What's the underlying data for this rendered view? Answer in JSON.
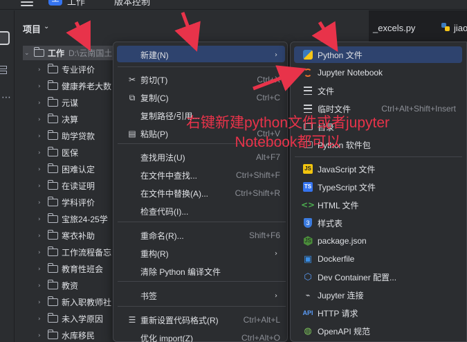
{
  "topbar": {
    "project_badge": "工",
    "project_name": "工作",
    "vcs_label": "版本控制"
  },
  "sidebar": {
    "header_label": "项目",
    "header_chevron": "⌄"
  },
  "editor_tabs": [
    {
      "label": "_excels.py"
    },
    {
      "label": "jiao"
    }
  ],
  "tree": {
    "root": {
      "label": "工作",
      "path": "D:\\云南国土"
    },
    "items": [
      "专业评价",
      "健康养老大数",
      "元谋",
      "决算",
      "助学贷款",
      "医保",
      "困难认定",
      "在读证明",
      "学科评价",
      "宝旅24-25学",
      "寒衣补助",
      "工作流程备忘",
      "教育性班会",
      "教资",
      "新入职教师社",
      "未入学原因",
      "水库移民"
    ]
  },
  "context_menu": {
    "items": [
      {
        "label": "新建(N)",
        "shortcut": "",
        "icon": "",
        "submenu": true
      },
      {
        "label": "剪切(T)",
        "shortcut": "Ctrl+X",
        "icon": "scissors-icon"
      },
      {
        "label": "复制(C)",
        "shortcut": "Ctrl+C",
        "icon": "copy-icon"
      },
      {
        "label": "复制路径/引用...",
        "shortcut": "",
        "icon": ""
      },
      {
        "label": "粘贴(P)",
        "shortcut": "Ctrl+V",
        "icon": "paste-icon"
      },
      {
        "label": "查找用法(U)",
        "shortcut": "Alt+F7",
        "icon": ""
      },
      {
        "label": "在文件中查找...",
        "shortcut": "Ctrl+Shift+F",
        "icon": ""
      },
      {
        "label": "在文件中替换(A)...",
        "shortcut": "Ctrl+Shift+R",
        "icon": ""
      },
      {
        "label": "检查代码(I)...",
        "shortcut": "",
        "icon": ""
      },
      {
        "label": "重命名(R)...",
        "shortcut": "Shift+F6",
        "icon": ""
      },
      {
        "label": "重构(R)",
        "shortcut": "",
        "icon": "",
        "submenu": true
      },
      {
        "label": "清除 Python 编译文件",
        "shortcut": "",
        "icon": ""
      },
      {
        "label": "书签",
        "shortcut": "",
        "icon": "",
        "submenu": true
      },
      {
        "label": "重新设置代码格式(R)",
        "shortcut": "Ctrl+Alt+L",
        "icon": "format-icon"
      },
      {
        "label": "优化 import(Z)",
        "shortcut": "Ctrl+Alt+O",
        "icon": ""
      }
    ]
  },
  "new_submenu": {
    "items": [
      {
        "label": "Python 文件",
        "shortcut": "",
        "icon": "python-file-icon"
      },
      {
        "label": "Jupyter Notebook",
        "shortcut": "",
        "icon": "jupyter-icon"
      },
      {
        "label": "文件",
        "shortcut": "",
        "icon": "file-icon"
      },
      {
        "label": "临时文件",
        "shortcut": "Ctrl+Alt+Shift+Insert",
        "icon": "scratch-file-icon"
      },
      {
        "label": "目录",
        "shortcut": "",
        "icon": "directory-icon"
      },
      {
        "label": "Python 软件包",
        "shortcut": "",
        "icon": "python-package-icon"
      },
      {
        "label": "JavaScript 文件",
        "shortcut": "",
        "icon": "javascript-icon",
        "glyph": "JS"
      },
      {
        "label": "TypeScript 文件",
        "shortcut": "",
        "icon": "typescript-icon",
        "glyph": "TS"
      },
      {
        "label": "HTML 文件",
        "shortcut": "",
        "icon": "html-icon",
        "glyph": "<>"
      },
      {
        "label": "样式表",
        "shortcut": "",
        "icon": "stylesheet-icon",
        "glyph": "3"
      },
      {
        "label": "package.json",
        "shortcut": "",
        "icon": "nodejs-icon",
        "glyph": "JS"
      },
      {
        "label": "Dockerfile",
        "shortcut": "",
        "icon": "docker-icon"
      },
      {
        "label": "Dev Container 配置...",
        "shortcut": "",
        "icon": "dev-container-icon"
      },
      {
        "label": "Jupyter 连接",
        "shortcut": "",
        "icon": "jupyter-connection-icon"
      },
      {
        "label": "HTTP 请求",
        "shortcut": "",
        "icon": "http-request-icon",
        "glyph": "API"
      },
      {
        "label": "OpenAPI 规范",
        "shortcut": "",
        "icon": "openapi-icon"
      }
    ]
  },
  "annotation": {
    "line1": "右键新建python文件或者jupyter",
    "line2": "Notebook都可以",
    "color": "#e8334a"
  },
  "colors": {
    "background": "#2b2d30",
    "highlight": "#2e436e",
    "accent": "#3574f0",
    "annotation_red": "#e8334a"
  }
}
